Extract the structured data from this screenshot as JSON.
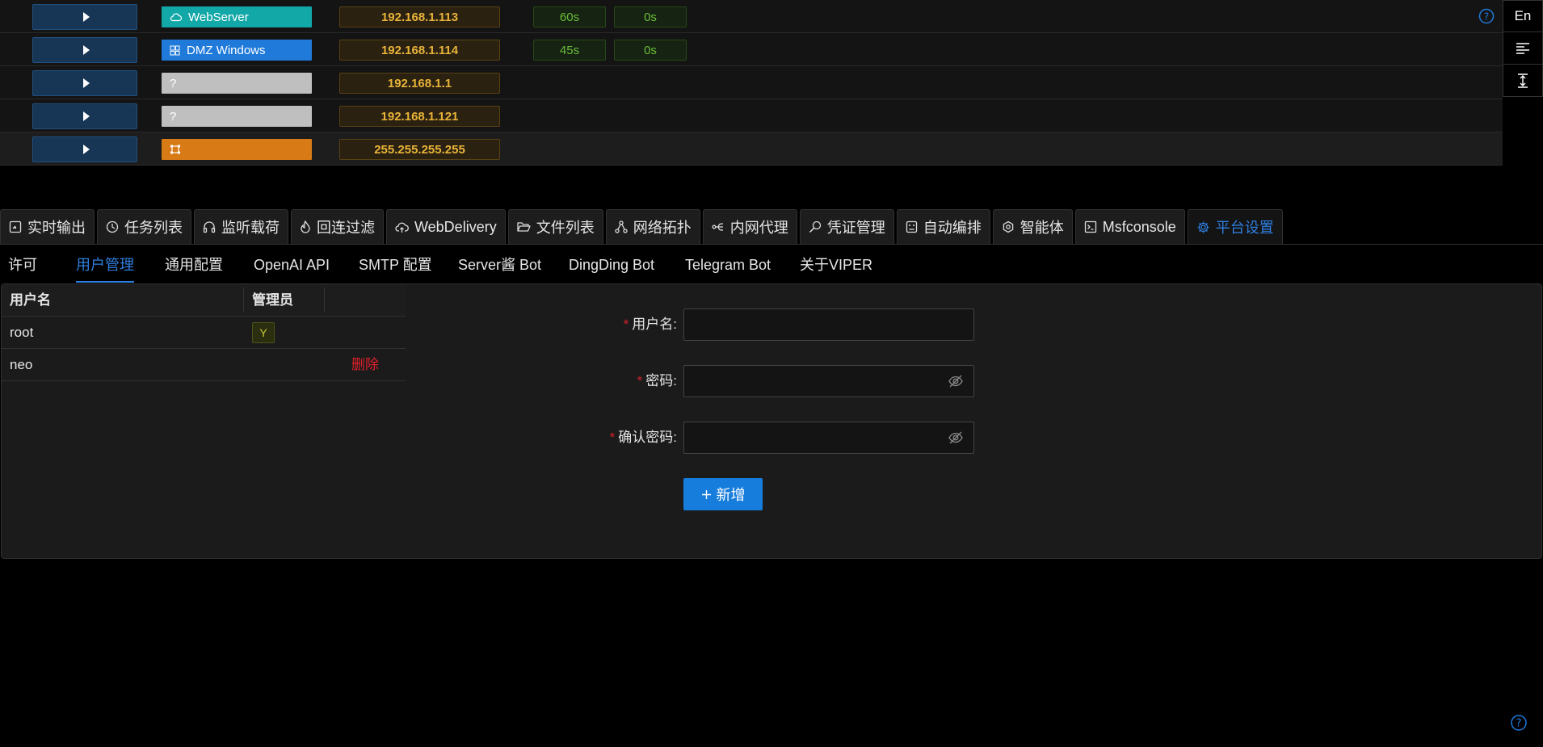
{
  "hosts": [
    {
      "os": "WebServer",
      "os_icon": "cloud-icon",
      "os_color": "#13a8a8",
      "ip": "192.168.1.113",
      "t1": "60s",
      "t2": "0s"
    },
    {
      "os": "DMZ Windows",
      "os_icon": "windows-icon",
      "os_color": "#1f7ad9",
      "ip": "192.168.1.114",
      "t1": "45s",
      "t2": "0s"
    },
    {
      "os": "",
      "os_icon": "question-icon",
      "os_color": "#bfbfbf",
      "ip": "192.168.1.1"
    },
    {
      "os": "",
      "os_icon": "question-icon",
      "os_color": "#bfbfbf",
      "ip": "192.168.1.121"
    },
    {
      "os": "",
      "os_icon": "gateway-icon",
      "os_color": "#d87a16",
      "ip": "255.255.255.255"
    }
  ],
  "toolbar": {
    "lang": "En"
  },
  "main_tabs": [
    {
      "label": "实时输出",
      "icon": "dashboard-icon"
    },
    {
      "label": "任务列表",
      "icon": "clock-icon"
    },
    {
      "label": "监听载荷",
      "icon": "headphones-icon"
    },
    {
      "label": "回连过滤",
      "icon": "flame-icon"
    },
    {
      "label": "WebDelivery",
      "icon": "cloud-upload-icon"
    },
    {
      "label": "文件列表",
      "icon": "folder-icon"
    },
    {
      "label": "网络拓扑",
      "icon": "topology-icon"
    },
    {
      "label": "内网代理",
      "icon": "proxy-icon"
    },
    {
      "label": "凭证管理",
      "icon": "search-key-icon"
    },
    {
      "label": "自动编排",
      "icon": "robot-icon"
    },
    {
      "label": "智能体",
      "icon": "agent-icon"
    },
    {
      "label": "Msfconsole",
      "icon": "terminal-icon"
    },
    {
      "label": "平台设置",
      "icon": "gear-icon",
      "active": true
    }
  ],
  "sub_tabs": [
    "许可",
    "用户管理",
    "通用配置",
    "OpenAI API",
    "SMTP 配置",
    "Server酱 Bot",
    "DingDing Bot",
    "Telegram Bot",
    "关于VIPER"
  ],
  "users_table": {
    "headers": [
      "用户名",
      "管理员"
    ],
    "rows": [
      {
        "name": "root",
        "admin": "Y"
      },
      {
        "name": "neo",
        "action": "删除"
      }
    ]
  },
  "form": {
    "username_label": "用户名:",
    "password_label": "密码:",
    "confirm_label": "确认密码:",
    "required_mark": "*",
    "add_label": "新增"
  },
  "colors": {
    "accent": "#177ddc",
    "ip": "#e8b339",
    "time": "#6abe39",
    "danger": "#e0202a"
  }
}
